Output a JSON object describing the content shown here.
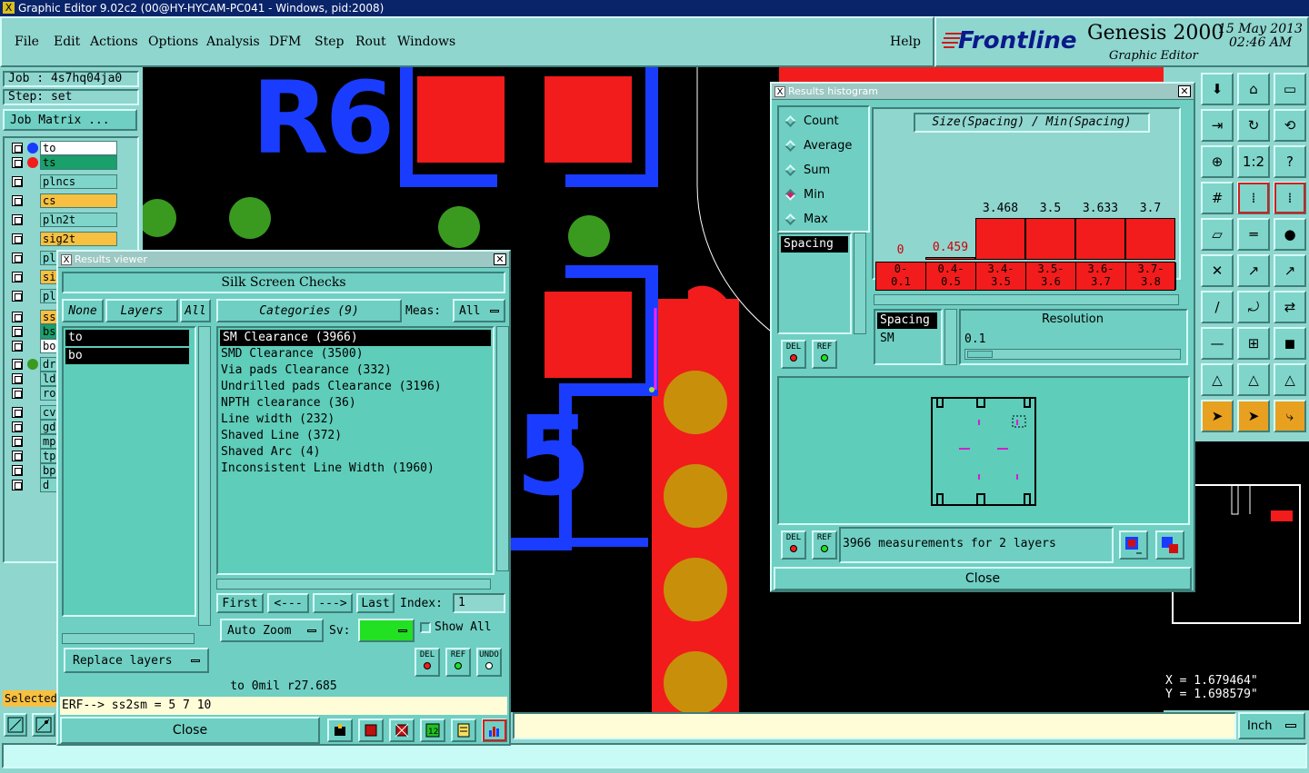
{
  "window": {
    "title": "Graphic Editor 9.02c2 (00@HY-HYCAM-PC041 - Windows, pid:2008)"
  },
  "menu": {
    "items": [
      "File",
      "Edit",
      "Actions",
      "Options",
      "Analysis",
      "DFM",
      "Step",
      "Rout",
      "Windows"
    ],
    "help": "Help"
  },
  "brand": {
    "logo": "Frontline",
    "product": "Genesis 2000",
    "subtitle": "Graphic Editor",
    "date": "15 May 2013",
    "time": "02:46 AM"
  },
  "job": {
    "job_label": "Job : 4s7hq04ja0",
    "step_label": "Step: set",
    "matrix_button": "Job Matrix ..."
  },
  "layers": [
    {
      "name": "to",
      "dot": "#1a3cff",
      "bg": "#ffffff"
    },
    {
      "name": "ts",
      "dot": "#f21c1c",
      "bg": "#1aa06a"
    },
    {
      "name": "plncs",
      "dot": "",
      "bg": "#7fd5ca"
    },
    {
      "name": "cs",
      "dot": "",
      "bg": "#f8c040"
    },
    {
      "name": "pln2t",
      "dot": "",
      "bg": "#7fd5ca"
    },
    {
      "name": "sig2t",
      "dot": "",
      "bg": "#f8c040"
    },
    {
      "name": "pl",
      "dot": "",
      "bg": "#7fd5ca"
    },
    {
      "name": "si",
      "dot": "",
      "bg": "#f8c040"
    },
    {
      "name": "pl",
      "dot": "",
      "bg": "#7fd5ca"
    },
    {
      "name": "ss",
      "dot": "",
      "bg": "#f8c040"
    },
    {
      "name": "bs",
      "dot": "",
      "bg": "#1aa06a"
    },
    {
      "name": "bo",
      "dot": "",
      "bg": "#ffffff"
    },
    {
      "name": "dr",
      "dot": "#3a9a20",
      "bg": "#7fd5ca"
    },
    {
      "name": "ld",
      "dot": "",
      "bg": "#7fd5ca"
    },
    {
      "name": "rou",
      "dot": "",
      "bg": "#7fd5ca"
    },
    {
      "name": "cv",
      "dot": "",
      "bg": "#7fd5ca"
    },
    {
      "name": "gd",
      "dot": "",
      "bg": "#7fd5ca"
    },
    {
      "name": "mpt",
      "dot": "",
      "bg": "#7fd5ca"
    },
    {
      "name": "tp",
      "dot": "",
      "bg": "#7fd5ca"
    },
    {
      "name": "bp",
      "dot": "",
      "bg": "#7fd5ca"
    },
    {
      "name": "d",
      "dot": "",
      "bg": "#7fd5ca"
    }
  ],
  "selected_label": "Selected",
  "canvas": {
    "text_r6": "R6",
    "text_5": "5"
  },
  "coords": {
    "x": "X = 1.679464\"",
    "y": "Y = 1.698579\""
  },
  "units": "Inch",
  "results_viewer": {
    "title": "Results viewer",
    "heading": "Silk Screen Checks",
    "none_btn": "None",
    "layers_btn": "Layers",
    "all_btn": "All",
    "categories_btn": "Categories (9)",
    "meas_label": "Meas:",
    "meas_value": "All",
    "layer_items": [
      "to",
      "bo"
    ],
    "category_items": [
      "SM Clearance (3966)",
      "SMD Clearance (3500)",
      "Via pads Clearance (332)",
      "Undrilled pads Clearance (3196)",
      "NPTH clearance (36)",
      "Line width (232)",
      "Shaved Line (372)",
      "Shaved Arc (4)",
      "Inconsistent Line Width (1960)"
    ],
    "first": "First",
    "prev": "<---",
    "next": "--->",
    "last": "Last",
    "index_label": "Index:",
    "index_value": "1",
    "zoom": "Auto Zoom",
    "sv_label": "Sv:",
    "show_all": "Show All",
    "replace": "Replace layers",
    "del": "DEL",
    "ref": "REF",
    "undo": "UNDO",
    "status": "to 0mil  r27.685",
    "erf": "ERF--> ss2sm = 5 7 10",
    "close": "Close"
  },
  "histogram": {
    "title": "Results histogram",
    "modes": [
      "Count",
      "Average",
      "Sum",
      "Min",
      "Max"
    ],
    "selected_mode": "Min",
    "chart_title": "Size(Spacing) / Min(Spacing)",
    "list_item": "Spacing",
    "del": "DEL",
    "ref": "REF",
    "meas_list": [
      "Spacing",
      "SM"
    ],
    "resolution_label": "Resolution",
    "resolution_value": "0.1",
    "summary": "3966 measurements for 2 layers",
    "close": "Close"
  },
  "chart_data": {
    "type": "bar",
    "title": "Size(Spacing) / Min(Spacing)",
    "categories": [
      "0-0.1",
      "0.4-0.5",
      "3.4-3.5",
      "3.5-3.6",
      "3.6-3.7",
      "3.7-3.8"
    ],
    "bin_labels": [
      [
        "0-",
        "0.1"
      ],
      [
        "0.4-",
        "0.5"
      ],
      [
        "3.4-",
        "3.5"
      ],
      [
        "3.5-",
        "3.6"
      ],
      [
        "3.6-",
        "3.7"
      ],
      [
        "3.7-",
        "3.8"
      ]
    ],
    "values": [
      0,
      0.459,
      3.468,
      3.5,
      3.633,
      3.7
    ],
    "value_labels": [
      "0",
      "0.459",
      "3.468",
      "3.5",
      "3.633",
      "3.7"
    ],
    "bar_heights": [
      0,
      0.06,
      1,
      1,
      1,
      1
    ],
    "label_colors": [
      "#d00000",
      "#d00000",
      "#000000",
      "#000000",
      "#000000",
      "#000000"
    ]
  }
}
